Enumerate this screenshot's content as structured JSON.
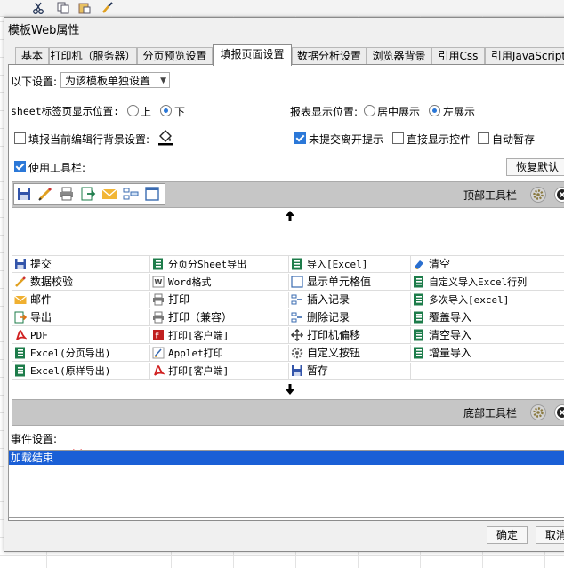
{
  "window": {
    "title": "模板Web属性"
  },
  "tabs": [
    {
      "label": "基本"
    },
    {
      "label": "打印机（服务器）"
    },
    {
      "label": "分页预览设置"
    },
    {
      "label": "填报页面设置"
    },
    {
      "label": "数据分析设置"
    },
    {
      "label": "浏览器背景"
    },
    {
      "label": "引用Css"
    },
    {
      "label": "引用JavaScript"
    }
  ],
  "settings": {
    "scope_label": "以下设置:",
    "scope_value": "为该模板单独设置",
    "sheet_pos_label": "sheet标签页显示位置:",
    "sheet_pos_up": "上",
    "sheet_pos_down": "下",
    "report_pos_label": "报表显示位置:",
    "report_pos_center": "居中展示",
    "report_pos_left": "左展示",
    "fill_bg_label": "填报当前编辑行背景设置:",
    "unsubmitted_label": "未提交离开提示",
    "direct_widget_label": "直接显示控件",
    "auto_save_label": "自动暂存",
    "use_toolbar_label": "使用工具栏:",
    "restore_default": "恢复默认"
  },
  "toolbar_config": {
    "top_label": "顶部工具栏",
    "bottom_label": "底部工具栏"
  },
  "buttons": [
    {
      "label": "提交",
      "icon": "save-icon",
      "color": "#3355aa"
    },
    {
      "label": "分页分Sheet导出",
      "icon": "excel-icon",
      "color": "#1d7c4a"
    },
    {
      "label": "导入[Excel]",
      "icon": "excel-icon",
      "color": "#1d7c4a"
    },
    {
      "label": "清空",
      "icon": "eraser-icon",
      "color": "#2a6fcf"
    },
    {
      "label": "数据校验",
      "icon": "pencil-icon",
      "color": "#e0a020"
    },
    {
      "label": "Word格式",
      "icon": "word-icon",
      "color": "#444444"
    },
    {
      "label": "显示单元格值",
      "icon": "cell-icon",
      "color": "#3a6bb0"
    },
    {
      "label": "自定义导入Excel行列",
      "icon": "excel-icon",
      "color": "#1d7c4a"
    },
    {
      "label": "邮件",
      "icon": "mail-icon",
      "color": "#f0b030"
    },
    {
      "label": "打印",
      "icon": "print-icon",
      "color": "#777777"
    },
    {
      "label": "插入记录",
      "icon": "insert-row-icon",
      "color": "#3a6bb0"
    },
    {
      "label": "多次导入[excel]",
      "icon": "excel-icon",
      "color": "#1d7c4a"
    },
    {
      "label": "导出",
      "icon": "export-icon",
      "color": "#e07010"
    },
    {
      "label": "打印（兼容）",
      "icon": "print-icon",
      "color": "#777777"
    },
    {
      "label": "删除记录",
      "icon": "delete-row-icon",
      "color": "#3a6bb0"
    },
    {
      "label": "覆盖导入",
      "icon": "excel-icon",
      "color": "#1d7c4a"
    },
    {
      "label": "PDF",
      "icon": "pdf-icon",
      "color": "#d02020"
    },
    {
      "label": "打印[客户端]",
      "icon": "flash-print-icon",
      "color": "#c02020"
    },
    {
      "label": "打印机偏移",
      "icon": "move-icon",
      "color": "#333333"
    },
    {
      "label": "清空导入",
      "icon": "excel-icon",
      "color": "#1d7c4a"
    },
    {
      "label": "Excel(分页导出)",
      "icon": "excel-icon",
      "color": "#1d7c4a"
    },
    {
      "label": "Applet打印",
      "icon": "applet-icon",
      "color": "#3a6bb0"
    },
    {
      "label": "自定义按钮",
      "icon": "gear-icon",
      "color": "#666666"
    },
    {
      "label": "增量导入",
      "icon": "excel-icon",
      "color": "#1d7c4a"
    },
    {
      "label": "Excel(原样导出)",
      "icon": "excel-icon",
      "color": "#1d7c4a"
    },
    {
      "label": "打印[客户端]",
      "icon": "pdf-icon",
      "color": "#d02020"
    },
    {
      "label": "暂存",
      "icon": "save-icon",
      "color": "#3355aa"
    }
  ],
  "events": {
    "label": "事件设置:",
    "items": [
      "加载结束"
    ]
  },
  "footer": {
    "ok": "确定",
    "cancel": "取消"
  }
}
